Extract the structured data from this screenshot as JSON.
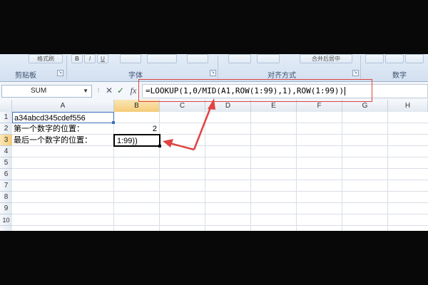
{
  "ribbon": {
    "groups": [
      {
        "label": "剪贴板"
      },
      {
        "label": "字体"
      },
      {
        "label": "对齐方式"
      },
      {
        "label": "数字"
      }
    ],
    "partial_buttons": [
      "格式刷",
      "B",
      "I",
      "U",
      "合并后居中"
    ]
  },
  "formula_bar": {
    "name_box": "SUM",
    "cancel_symbol": "✕",
    "enter_symbol": "✓",
    "fx_symbol": "fx",
    "formula": "=LOOKUP(1,0/MID(A1,ROW(1:99),1),ROW(1:99))"
  },
  "grid": {
    "columns": [
      "A",
      "B",
      "C",
      "D",
      "E",
      "F",
      "G",
      "H"
    ],
    "rows": [
      "1",
      "2",
      "3",
      "4",
      "5",
      "6",
      "7",
      "8",
      "9",
      "10"
    ],
    "cells": {
      "A1": "a34abcd345cdef556",
      "A2": "第一个数字的位置：",
      "B2": "2",
      "A3": "最后一个数字的位置：",
      "B3": "1:99))"
    },
    "active_cell": "B3",
    "selected_column": "B",
    "selected_row": "3"
  },
  "colors": {
    "annotation": "#e04343",
    "selection_header": "#f4cc78",
    "ribbon": "#dbe5f2"
  }
}
